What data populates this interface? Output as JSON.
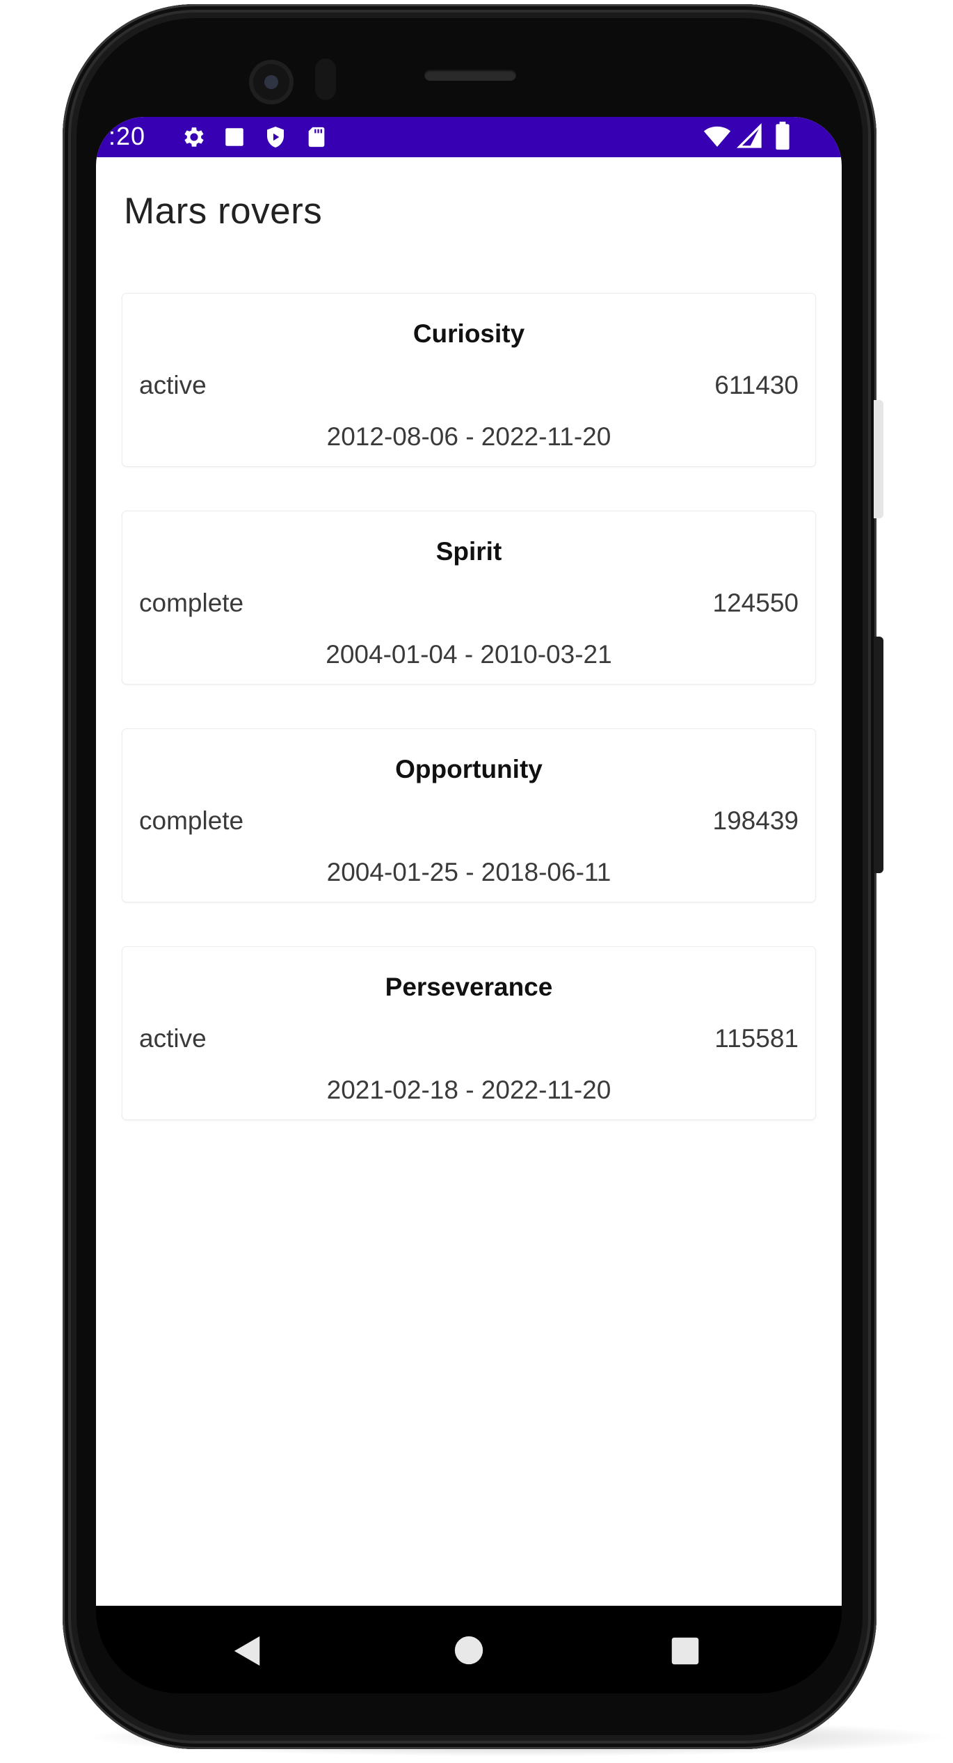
{
  "status_bar": {
    "time": ":20",
    "background_color": "#3700b3",
    "left_icons": [
      "settings-icon",
      "stop-icon",
      "play-protect-icon",
      "sd-card-icon"
    ],
    "right_icons": [
      "wifi-icon",
      "cellular-signal-icon",
      "battery-icon"
    ]
  },
  "app_bar": {
    "title": "Mars rovers"
  },
  "rovers": [
    {
      "name": "Curiosity",
      "status": "active",
      "photos": "611430",
      "dates": "2012-08-06 - 2022-11-20"
    },
    {
      "name": "Spirit",
      "status": "complete",
      "photos": "124550",
      "dates": "2004-01-04 - 2010-03-21"
    },
    {
      "name": "Opportunity",
      "status": "complete",
      "photos": "198439",
      "dates": "2004-01-25 - 2018-06-11"
    },
    {
      "name": "Perseverance",
      "status": "active",
      "photos": "115581",
      "dates": "2021-02-18 - 2022-11-20"
    }
  ],
  "nav_bar": {
    "icons": [
      "back-icon",
      "home-icon",
      "recents-icon"
    ]
  }
}
